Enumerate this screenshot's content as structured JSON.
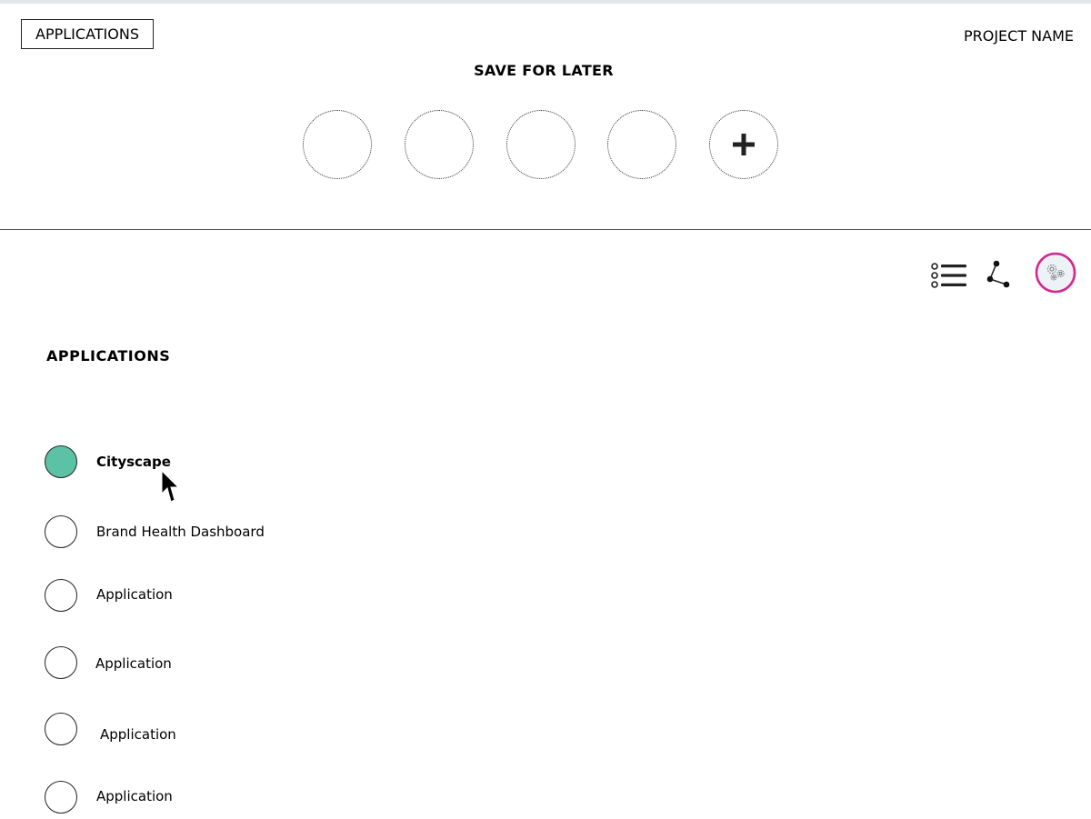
{
  "header": {
    "applications_button": "APPLICATIONS",
    "project_name": "PROJECT NAME",
    "save_for_later_title": "SAVE FOR LATER",
    "slots": [
      {
        "icon": "empty-slot"
      },
      {
        "icon": "empty-slot"
      },
      {
        "icon": "empty-slot"
      },
      {
        "icon": "empty-slot"
      },
      {
        "icon": "plus-icon"
      }
    ],
    "add_slot_label": "+"
  },
  "toolbar": {
    "icons": [
      "list-view-icon",
      "network-view-icon",
      "gears-settings-icon"
    ],
    "active_ring_color": "#d6268f"
  },
  "applications": {
    "title": "APPLICATIONS",
    "selected_color": "#5bc2a6",
    "items": [
      {
        "label": "Cityscape",
        "selected": true
      },
      {
        "label": "Brand Health Dashboard",
        "selected": false
      },
      {
        "label": "Application",
        "selected": false
      },
      {
        "label": "Application",
        "selected": false
      },
      {
        "label": "Application",
        "selected": false
      },
      {
        "label": "Application",
        "selected": false
      }
    ]
  }
}
